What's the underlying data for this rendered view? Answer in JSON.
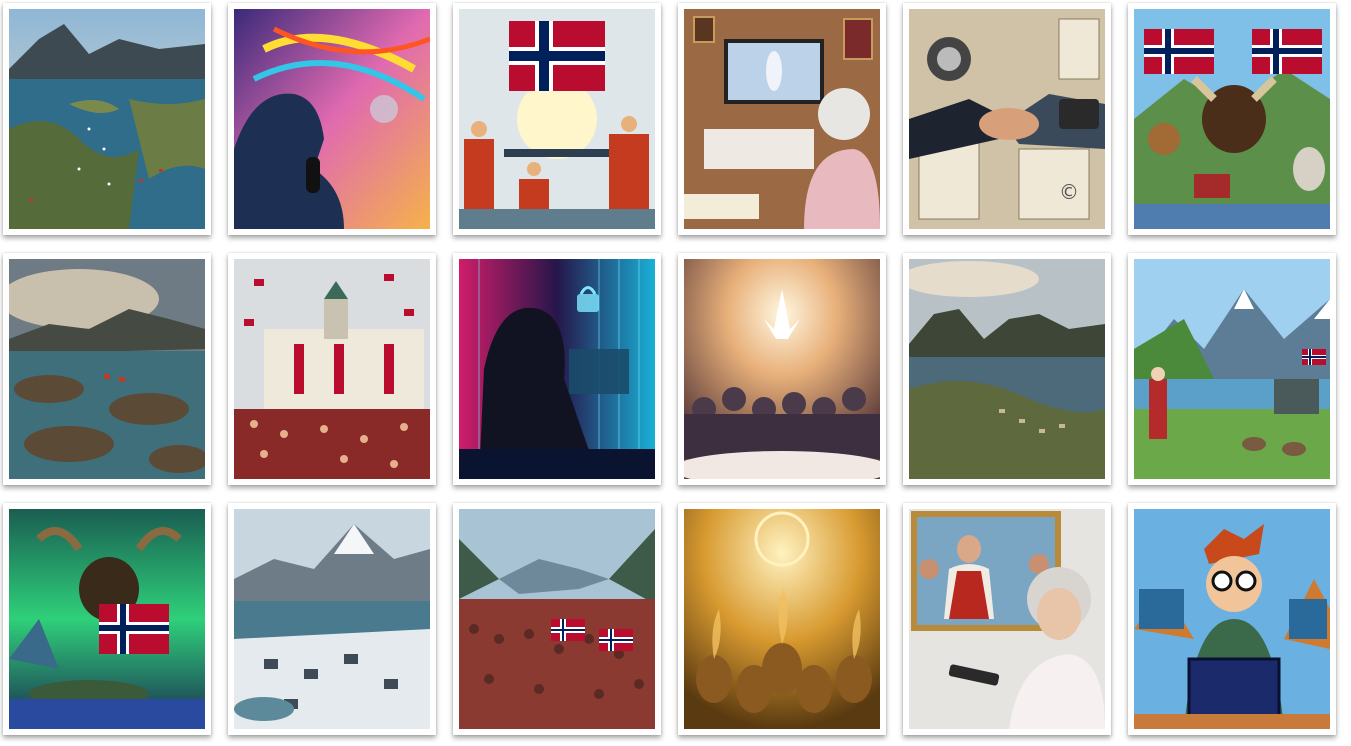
{
  "gallery": {
    "rows": 3,
    "columns": 6,
    "tiles": [
      {
        "subject": "fjord-archipelago"
      },
      {
        "subject": "singer-with-microphone"
      },
      {
        "subject": "norwegian-flag-workers"
      },
      {
        "subject": "grandmother-watching-tv"
      },
      {
        "subject": "handshake-copyright"
      },
      {
        "subject": "moose-trolls-flags"
      },
      {
        "subject": "stormy-coast-rocks"
      },
      {
        "subject": "building-crowd-flags"
      },
      {
        "subject": "hooded-hacker"
      },
      {
        "subject": "radiant-figure-crowd"
      },
      {
        "subject": "lofoten-aerial"
      },
      {
        "subject": "mountain-valley-folk-costume"
      },
      {
        "subject": "aurora-moose-flag"
      },
      {
        "subject": "snowy-harbor-town"
      },
      {
        "subject": "fjord-parade-flags"
      },
      {
        "subject": "golden-flame-faces"
      },
      {
        "subject": "grandmother-remote-painting"
      },
      {
        "subject": "cartoon-gamer-glasses"
      }
    ]
  },
  "colors": {
    "flag_red": "#ba0c2f",
    "flag_blue": "#00205b",
    "flag_white": "#ffffff",
    "background": "#ffffff"
  }
}
